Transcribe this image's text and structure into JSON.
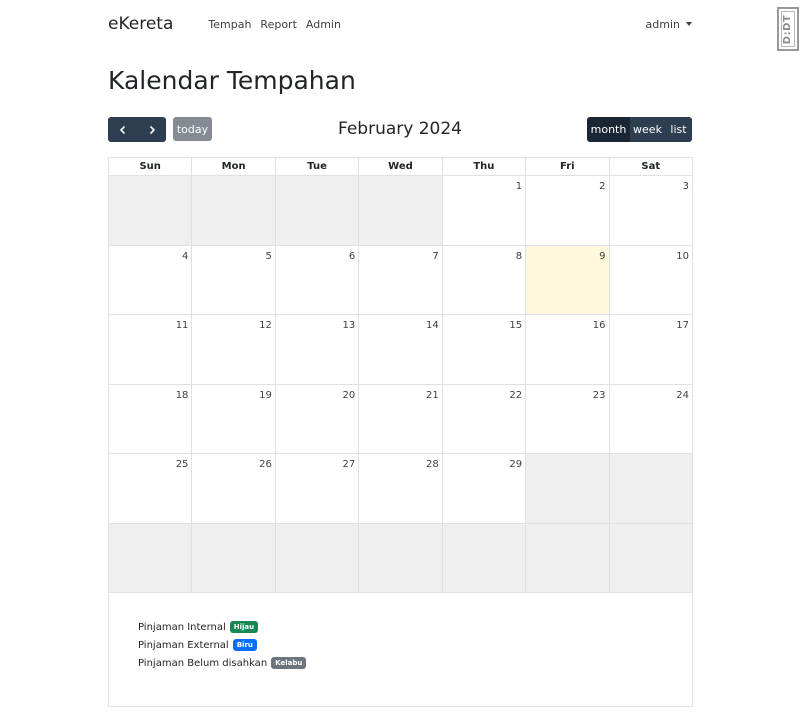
{
  "navbar": {
    "brand": "eKereta",
    "links": [
      "Tempah",
      "Report",
      "Admin"
    ],
    "user": "admin"
  },
  "watermark": "D:DT",
  "page_title": "Kalendar Tempahan",
  "toolbar": {
    "today_label": "today",
    "title": "February 2024",
    "views": [
      "month",
      "week",
      "list"
    ],
    "active_view": "month",
    "prev_icon": "chevron-left-icon",
    "next_icon": "chevron-right-icon"
  },
  "calendar": {
    "weekdays": [
      "Sun",
      "Mon",
      "Tue",
      "Wed",
      "Thu",
      "Fri",
      "Sat"
    ],
    "weeks": [
      [
        "",
        "",
        "",
        "",
        "1",
        "2",
        "3"
      ],
      [
        "4",
        "5",
        "6",
        "7",
        "8",
        "9",
        "10"
      ],
      [
        "11",
        "12",
        "13",
        "14",
        "15",
        "16",
        "17"
      ],
      [
        "18",
        "19",
        "20",
        "21",
        "22",
        "23",
        "24"
      ],
      [
        "25",
        "26",
        "27",
        "28",
        "29",
        "",
        ""
      ],
      [
        "",
        "",
        "",
        "",
        "",
        "",
        ""
      ]
    ],
    "today": "9",
    "today_color": "#fff8dc",
    "other_month_color": "#efefef"
  },
  "legend": [
    {
      "label": "Pinjaman Internal",
      "badge": "Hijau",
      "color": "#198754"
    },
    {
      "label": "Pinjaman External",
      "badge": "Biru",
      "color": "#0d6efd"
    },
    {
      "label": "Pinjaman Belum disahkan",
      "badge": "Kelabu",
      "color": "#6c757d"
    }
  ]
}
